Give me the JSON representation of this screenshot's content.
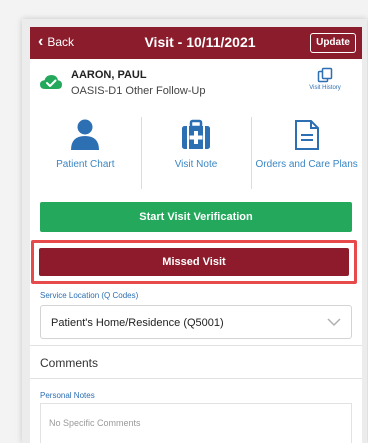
{
  "header": {
    "back_label": "Back",
    "title": "Visit - 10/11/2021",
    "update_label": "Update"
  },
  "patient": {
    "name": "AARON, PAUL",
    "visit_type": "OASIS-D1 Other Follow-Up",
    "history_label": "Visit History"
  },
  "tiles": [
    {
      "label": "Patient Chart",
      "icon": "person-icon"
    },
    {
      "label": "Visit Note",
      "icon": "medical-kit-icon"
    },
    {
      "label": "Orders and Care Plans",
      "icon": "document-icon"
    }
  ],
  "actions": {
    "start_verification": "Start Visit Verification",
    "missed_visit": "Missed Visit"
  },
  "service_location": {
    "label": "Service Location (Q Codes)",
    "value": "Patient's Home/Residence (Q5001)"
  },
  "comments": {
    "title": "Comments",
    "personal_notes_label": "Personal Notes",
    "personal_notes_placeholder": "No Specific Comments"
  },
  "colors": {
    "header_bg": "#8b1c2c",
    "verify_green": "#24a85c",
    "missed_red": "#8d1b2b",
    "highlight": "#e74a4a",
    "link_blue": "#2c6fb3"
  }
}
